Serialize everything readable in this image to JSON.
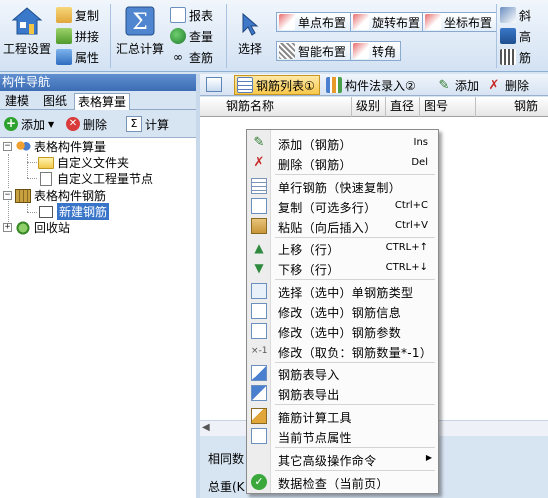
{
  "ribbon": {
    "project_settings": "工程设置",
    "copy": "复制",
    "stitch": "拼接",
    "attribute": "属性",
    "sum_calc": "汇总计算",
    "report": "报表",
    "check_amount": "查量",
    "check_rebar": "查筋",
    "select": "选择",
    "single_point_layout": "单点布置",
    "rotate_layout": "旋转布置",
    "coordinate_layout": "坐标布置",
    "smart_layout": "智能布置",
    "corner": "转角",
    "slant": "斜",
    "height": "高",
    "rebar": "筋"
  },
  "nav": {
    "title": "构件导航",
    "tabs": [
      "建模",
      "图纸",
      "表格算量"
    ],
    "add": "添加",
    "delete": "删除",
    "calc": "计算",
    "tree": {
      "table_component_qty": "表格构件算量",
      "custom_folder": "自定义文件夹",
      "custom_qty_node": "自定义工程量节点",
      "table_component_rebar": "表格构件钢筋",
      "new_rebar": "新建钢筋",
      "recycle_bin": "回收站"
    }
  },
  "right_toolbar": {
    "rebar_list": "钢筋列表①",
    "component_method": "构件法录入②",
    "add": "添加",
    "delete": "删除"
  },
  "grid": {
    "columns": [
      "钢筋名称",
      "级别",
      "直径",
      "图号",
      "钢筋"
    ],
    "bottom_label_1": "相同数",
    "bottom_label_2": "总重(K"
  },
  "context_menu": {
    "items": [
      {
        "label": "添加（钢筋）",
        "shortcut": "Ins"
      },
      {
        "label": "删除（钢筋）",
        "shortcut": "Del"
      },
      {
        "label": "单行钢筋（快速复制）",
        "shortcut": ""
      },
      {
        "label": "复制（可选多行）",
        "shortcut": "Ctrl+C"
      },
      {
        "label": "粘贴（向后插入）",
        "shortcut": "Ctrl+V"
      },
      {
        "label": "上移（行）",
        "shortcut": "CTRL+↑"
      },
      {
        "label": "下移（行）",
        "shortcut": "CTRL+↓"
      },
      {
        "label": "选择（选中）单钢筋类型",
        "shortcut": ""
      },
      {
        "label": "修改（选中）钢筋信息",
        "shortcut": ""
      },
      {
        "label": "修改（选中）钢筋参数",
        "shortcut": ""
      },
      {
        "label": "修改（取负：钢筋数量*-1）",
        "shortcut": ""
      },
      {
        "label": "钢筋表导入",
        "shortcut": ""
      },
      {
        "label": "钢筋表导出",
        "shortcut": ""
      },
      {
        "label": "箍筋计算工具",
        "shortcut": ""
      },
      {
        "label": "当前节点属性",
        "shortcut": ""
      },
      {
        "label": "其它高级操作命令",
        "shortcut": ""
      },
      {
        "label": "数据检查（当前页）",
        "shortcut": ""
      }
    ]
  },
  "colors": {
    "ribbon_bg": "#d3e2f3",
    "nav_title_bg": "#3c6db4",
    "selection": "#3874c8"
  }
}
